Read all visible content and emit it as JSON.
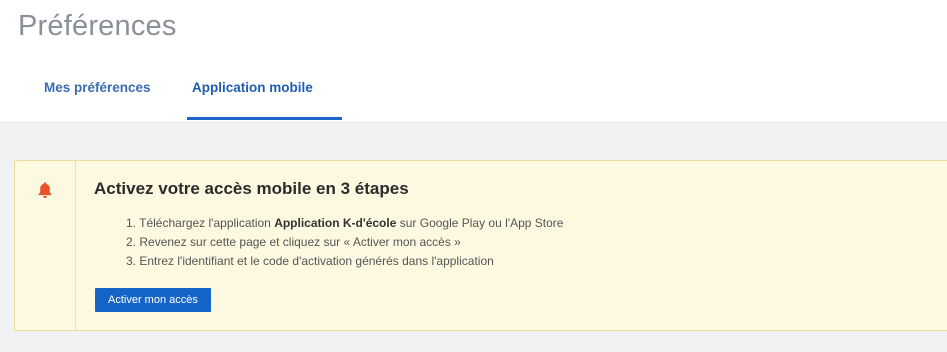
{
  "page": {
    "title": "Préférences"
  },
  "tabs": [
    {
      "label": "Mes préférences",
      "active": false
    },
    {
      "label": "Application mobile",
      "active": true
    }
  ],
  "alert": {
    "icon": "bell-icon",
    "title": "Activez votre accès mobile en 3 étapes",
    "steps": [
      {
        "number": "1.",
        "prefix": "Téléchargez l'application ",
        "bold": "Application K-d'école",
        "suffix": " sur Google Play ou l'App Store"
      },
      {
        "number": "2.",
        "text": "Revenez sur cette page et cliquez sur « Activer mon accès »"
      },
      {
        "number": "3.",
        "text": "Entrez l'identifiant et le code d'activation générés dans l'application"
      }
    ],
    "button_label": "Activer mon accès"
  },
  "colors": {
    "accent": "#1e64c8",
    "alert_background": "#fdf9e1",
    "bell": "#e8542a"
  }
}
